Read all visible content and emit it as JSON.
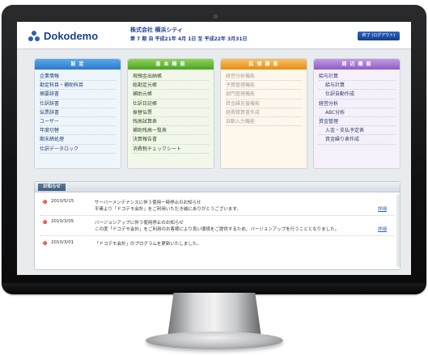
{
  "header": {
    "logo_text": "Dokodemo",
    "company": "株式会社 横浜シティ",
    "period": "第 7 期 自 平成21年 4月 1日  至 平成22年 3月31日",
    "logout_label": "終了 (ログアウト)"
  },
  "panels": [
    {
      "title": "設 定",
      "items": [
        "企業情報",
        "勘定科目・補助科目",
        "摘要辞書",
        "仕訳辞書",
        "伝票辞書",
        "ユーザー",
        "年度切替",
        "期末締処理",
        "仕訳データロック"
      ]
    },
    {
      "title": "基 本 機 能",
      "items": [
        "現預金出納帳",
        "総勘定元帳",
        "補助元帳",
        "仕訳日記帳",
        "振替伝票",
        "残高試算表",
        "補助残高一覧表",
        "決算報告書",
        "消費税チェックシート"
      ]
    },
    {
      "title": "拡 張 機 能",
      "items": [
        "経営分析機能",
        "予算管理機能",
        "部門管理機能",
        "資金繰支援機能",
        "経費精算書作成",
        "自動入力機能"
      ]
    },
    {
      "title": "周 辺 機 能",
      "items": [
        "給与計算",
        "給与計算",
        "仕訳自動作成",
        "経営分析",
        "ABC分析",
        "資金管理",
        "入金・支払予定表",
        "資金繰り表作成"
      ]
    }
  ],
  "notice": {
    "title": "お知らせ",
    "items": [
      {
        "date": "2010/5/15",
        "line1": "サーバーメンテナンスに伴う使用一時停止のお知らせ",
        "line2": "平素より「ドコデモ会計」をご利用いただき誠にありがとうございます。",
        "detail": "詳細"
      },
      {
        "date": "2010/3/05",
        "line1": "バージョンアップに伴う使用停止のお知らせ",
        "line2": "この度「ドコデモ会計」をご利用のお客様により良い環境をご提供するため、バージョンアップを行うこととなりました。",
        "detail": "詳細"
      },
      {
        "date": "2010/3/01",
        "line1": "「ドコデモ会計」のプログラムを更新いたしました。",
        "line2": "",
        "detail": "詳細"
      }
    ]
  }
}
